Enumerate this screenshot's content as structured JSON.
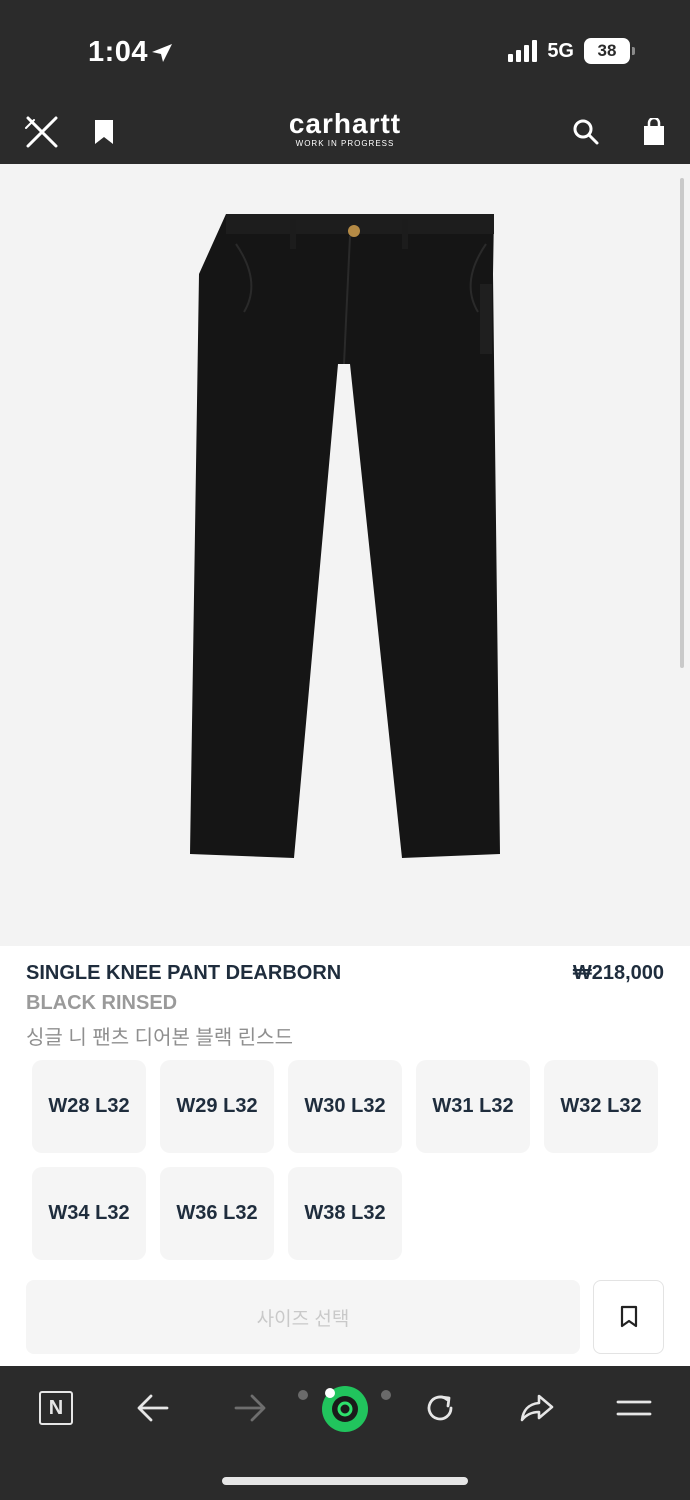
{
  "status_bar": {
    "time": "1:04",
    "network": "5G",
    "battery": "38"
  },
  "header": {
    "brand": "carhartt",
    "brand_sub": "WORK IN PROGRESS"
  },
  "product": {
    "title": "SINGLE KNEE PANT DEARBORN",
    "price": "₩218,000",
    "color": "BLACK RINSED",
    "name_ko": "싱글 니 팬츠 디어본 블랙 린스드"
  },
  "sizes": [
    "W28 L32",
    "W29 L32",
    "W30 L32",
    "W31 L32",
    "W32 L32",
    "W34 L32",
    "W36 L32",
    "W38 L32"
  ],
  "actions": {
    "select_size": "사이즈 선택"
  },
  "toolbar": {
    "n_label": "N"
  },
  "colors": {
    "bar_bg": "#2b2b2b",
    "image_bg": "#f3f3f3",
    "text_dark": "#1f2d3d",
    "green_accent": "#21c45d"
  }
}
